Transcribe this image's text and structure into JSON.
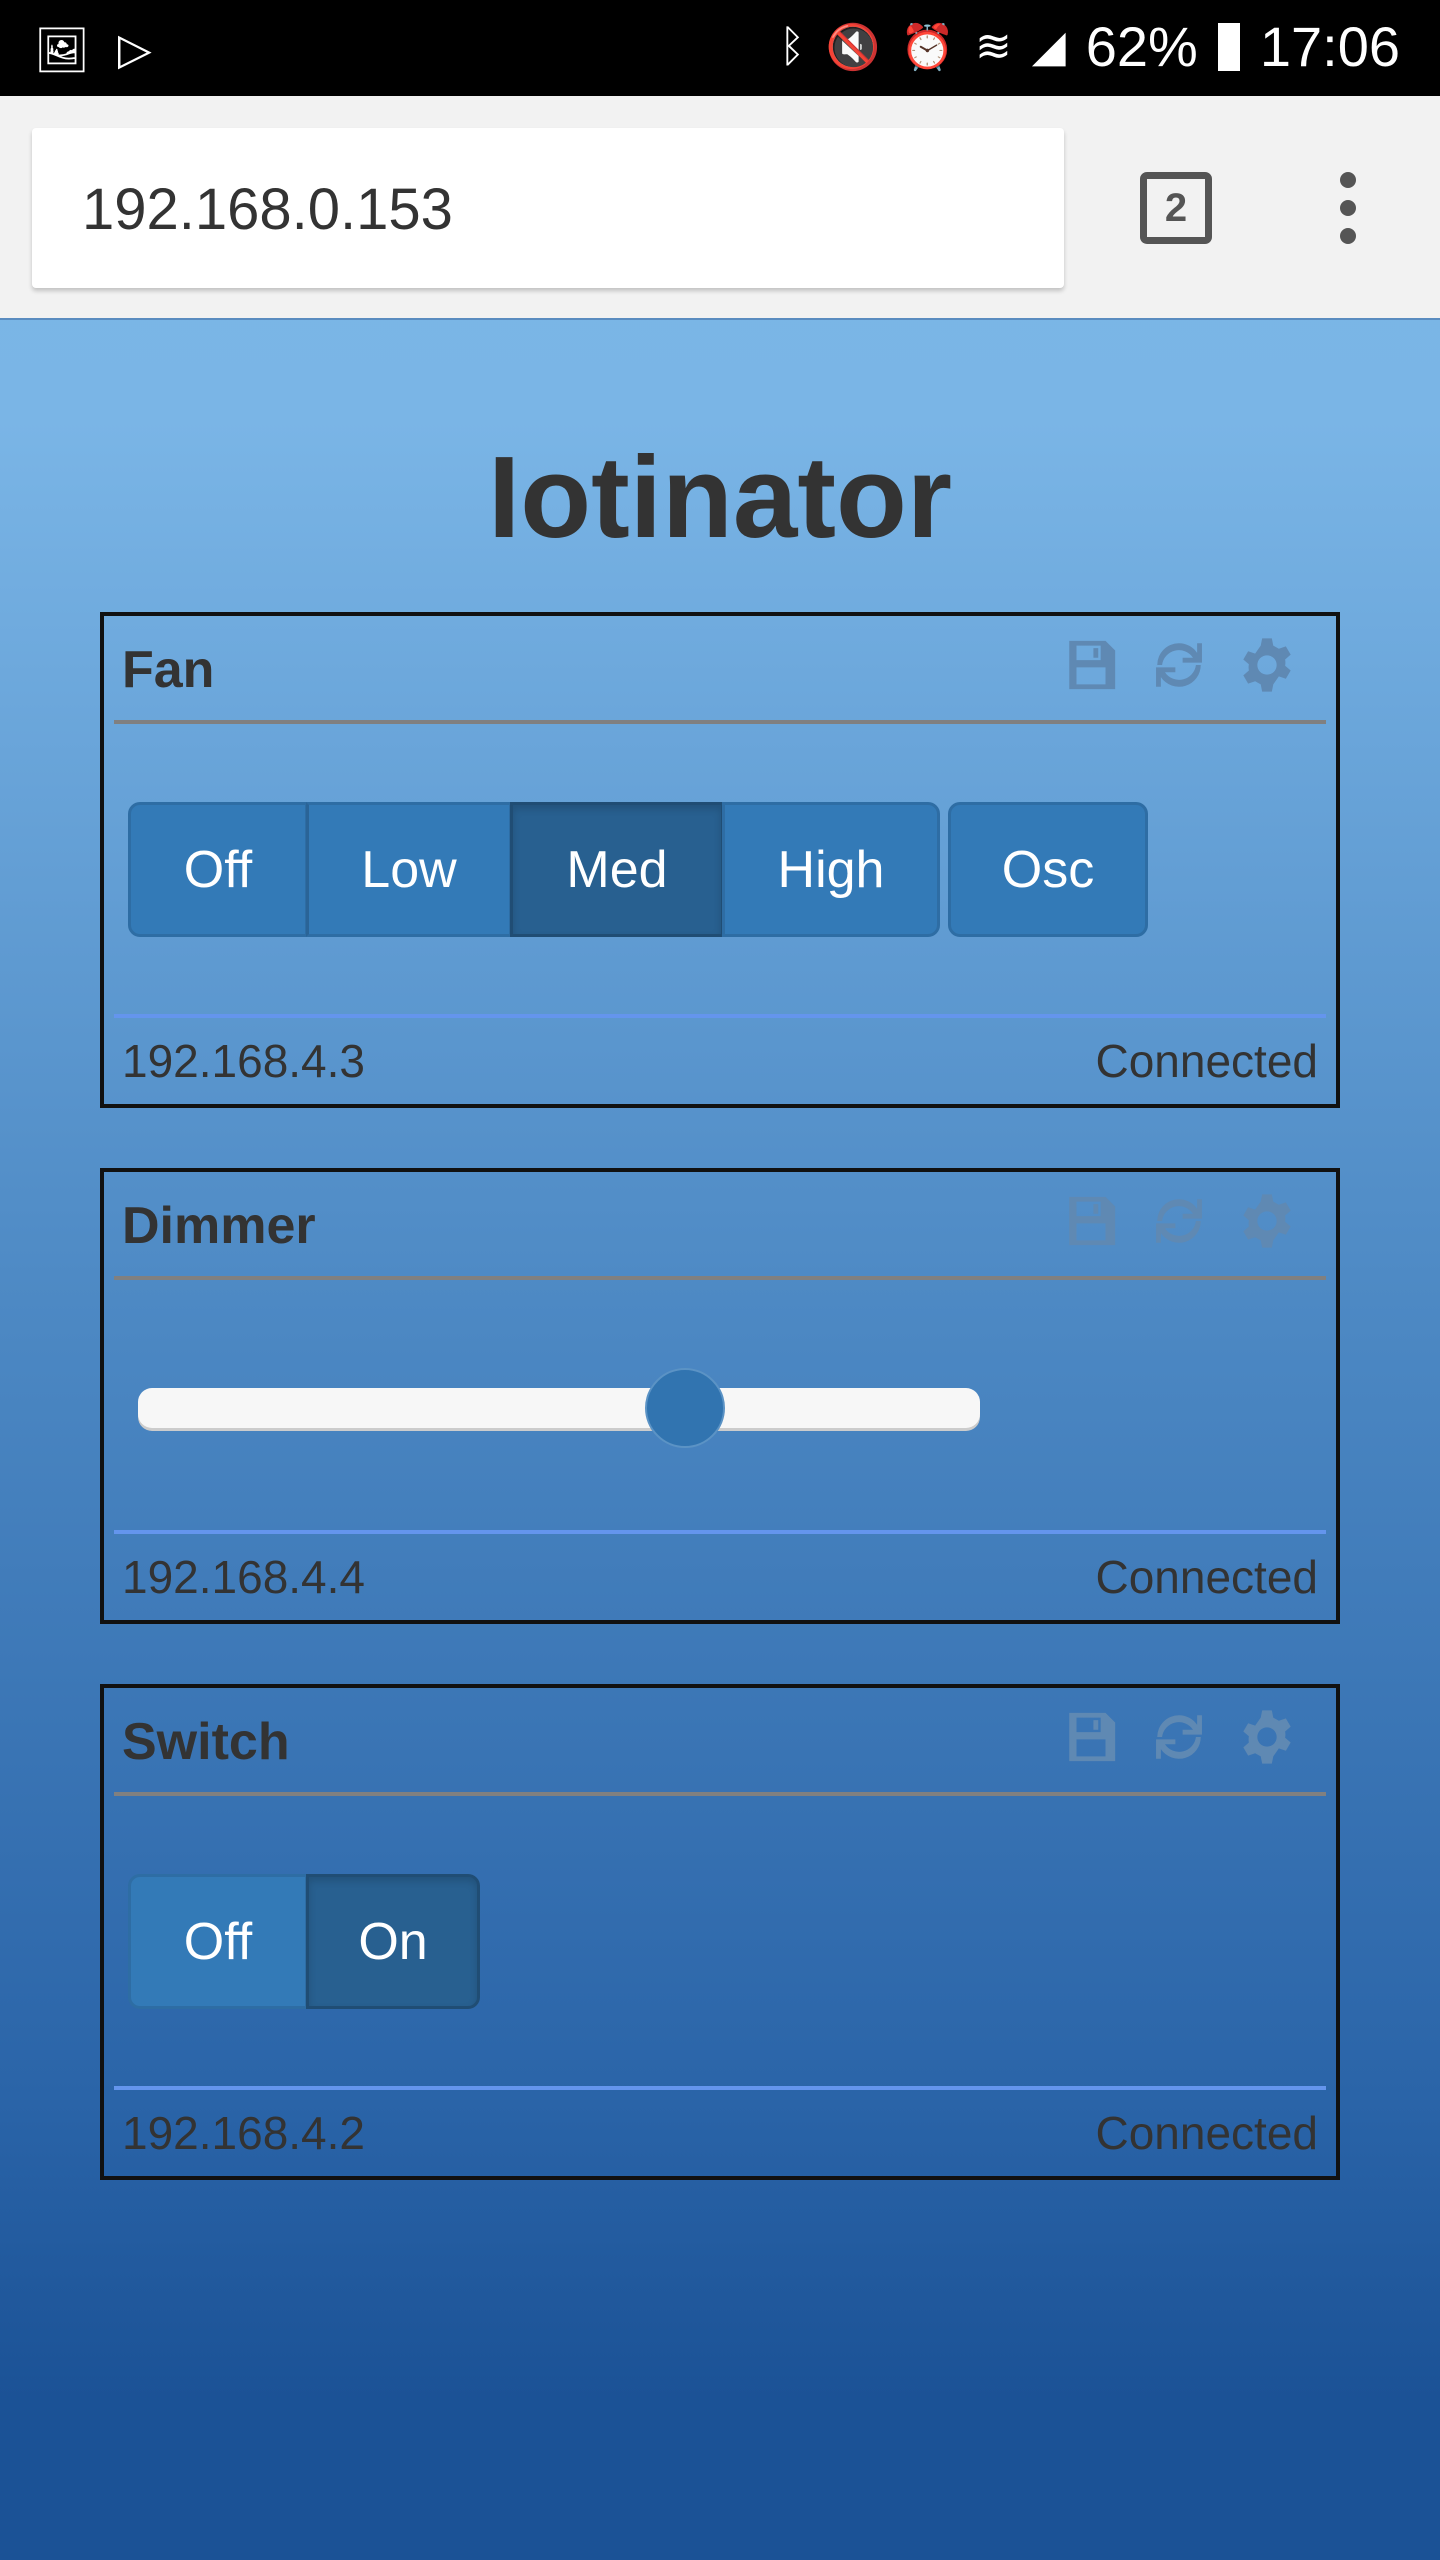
{
  "status_bar": {
    "battery": "62%",
    "time": "17:06",
    "icons": [
      "image-icon",
      "play-store-icon",
      "bluetooth-icon",
      "mute-icon",
      "alarm-icon",
      "wifi-icon",
      "signal-icon",
      "battery-icon"
    ]
  },
  "browser": {
    "url": "192.168.0.153",
    "tab_count": "2"
  },
  "page": {
    "title": "Iotinator"
  },
  "cards": [
    {
      "title": "Fan",
      "ip": "192.168.4.3",
      "status": "Connected",
      "buttons": [
        "Off",
        "Low",
        "Med",
        "High"
      ],
      "selected": "Med",
      "extra_button": "Osc"
    },
    {
      "title": "Dimmer",
      "ip": "192.168.4.4",
      "status": "Connected",
      "slider_value_percent": 65
    },
    {
      "title": "Switch",
      "ip": "192.168.4.2",
      "status": "Connected",
      "buttons": [
        "Off",
        "On"
      ],
      "selected": "On"
    }
  ],
  "colors": {
    "button": "#337ab7",
    "button_active": "#286090",
    "footer_line": "#6495ed"
  }
}
